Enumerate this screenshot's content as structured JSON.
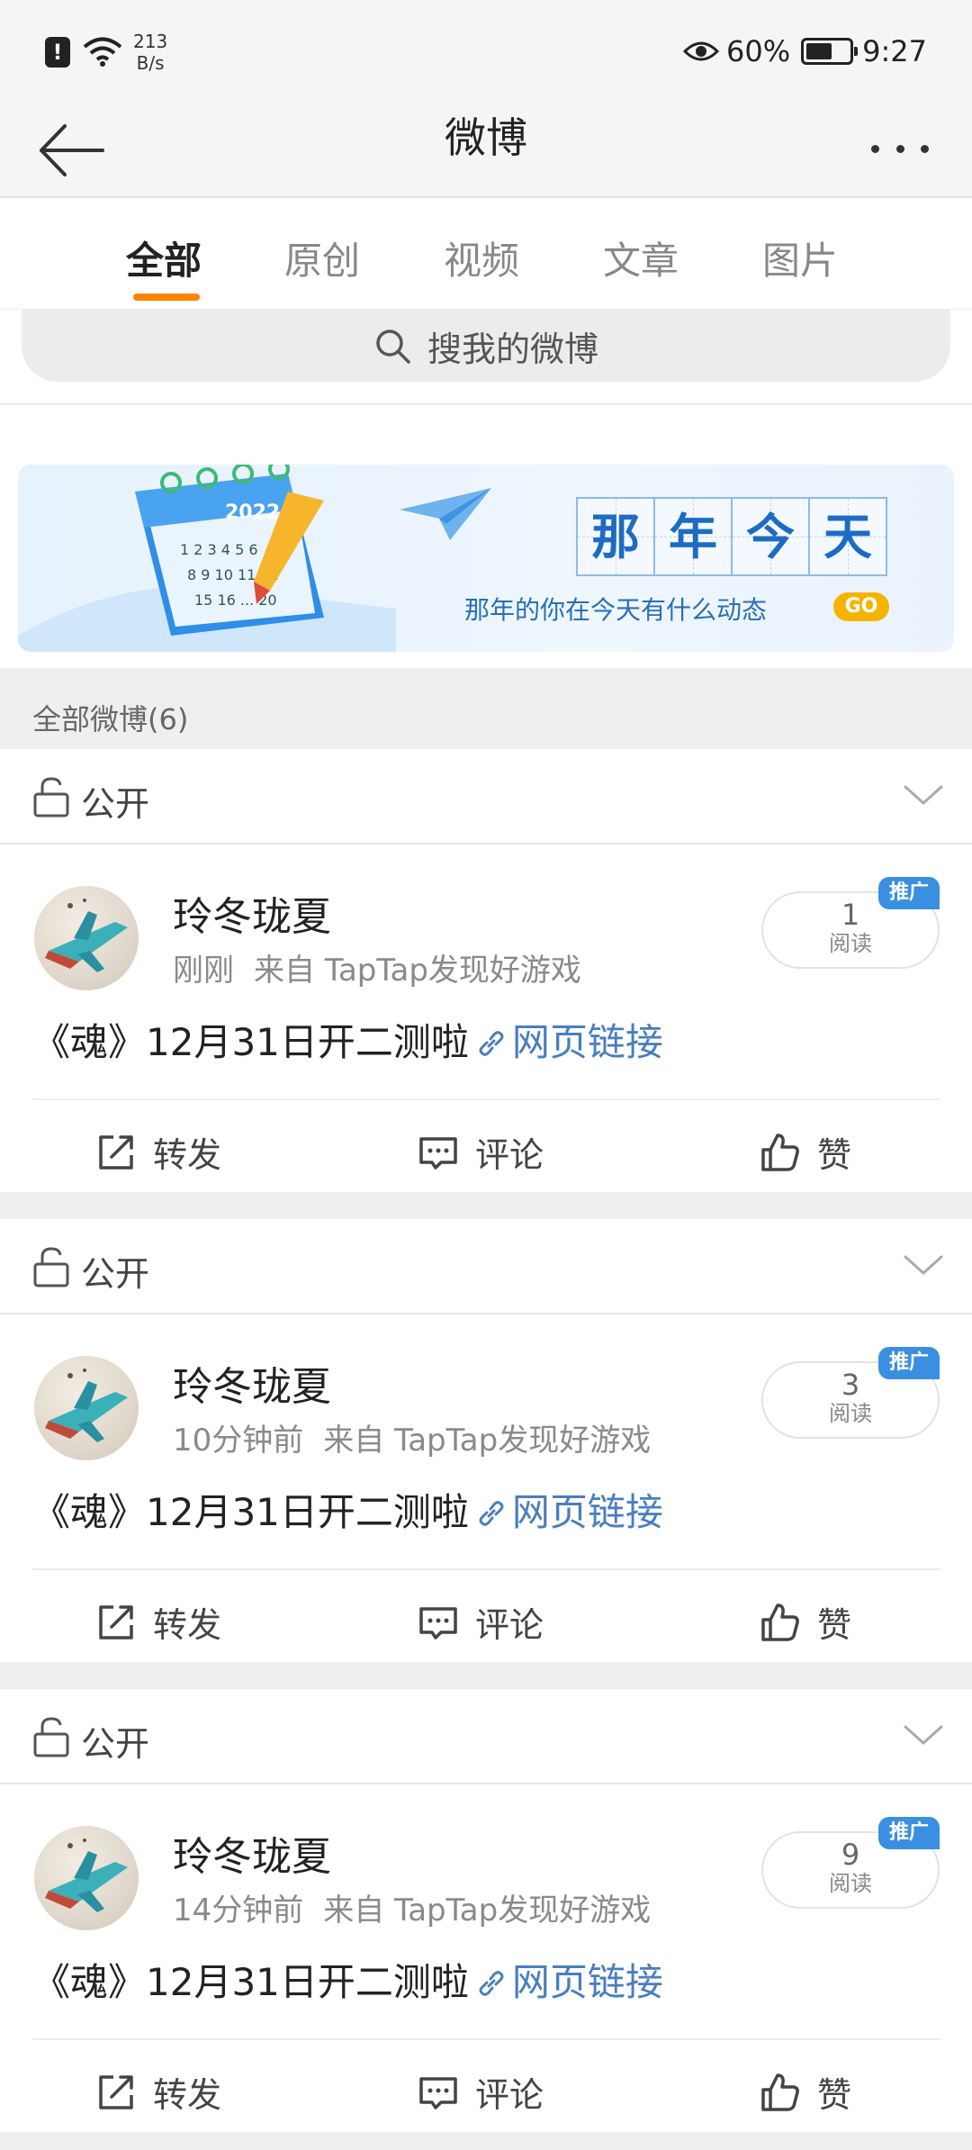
{
  "status_bar": {
    "net_speed_value": "213",
    "net_speed_unit": "B/s",
    "battery": "60%",
    "battery_level": 0.6,
    "time": "9:27"
  },
  "header": {
    "title": "微博"
  },
  "tabs": [
    {
      "label": "全部",
      "active": true
    },
    {
      "label": "原创",
      "active": false
    },
    {
      "label": "视频",
      "active": false
    },
    {
      "label": "文章",
      "active": false
    },
    {
      "label": "图片",
      "active": false
    }
  ],
  "search": {
    "placeholder": "搜我的微博"
  },
  "banner": {
    "cal_year": "2022",
    "title_chars": [
      "那",
      "年",
      "今",
      "天"
    ],
    "subtitle": "那年的你在今天有什么动态",
    "go": "GO"
  },
  "count": {
    "label": "全部微博(6)"
  },
  "posts": [
    {
      "privacy": "公开",
      "author": "玲冬珑夏",
      "time": "刚刚",
      "source": "来自 TapTap发现好游戏",
      "reads": "1",
      "reads_label": "阅读",
      "promo": "推广",
      "text": "《魂》12月31日开二测啦",
      "link_text": "网页链接",
      "actions": {
        "repost": "转发",
        "comment": "评论",
        "like": "赞"
      }
    },
    {
      "privacy": "公开",
      "author": "玲冬珑夏",
      "time": "10分钟前",
      "source": "来自 TapTap发现好游戏",
      "reads": "3",
      "reads_label": "阅读",
      "promo": "推广",
      "text": "《魂》12月31日开二测啦",
      "link_text": "网页链接",
      "actions": {
        "repost": "转发",
        "comment": "评论",
        "like": "赞"
      }
    },
    {
      "privacy": "公开",
      "author": "玲冬珑夏",
      "time": "14分钟前",
      "source": "来自 TapTap发现好游戏",
      "reads": "9",
      "reads_label": "阅读",
      "promo": "推广",
      "text": "《魂》12月31日开二测啦",
      "link_text": "网页链接",
      "actions": {
        "repost": "转发",
        "comment": "评论",
        "like": "赞"
      }
    }
  ],
  "colors": {
    "accent": "#ff8200",
    "link": "#4a7ebc",
    "promo": "#3a8fe0",
    "banner_text": "#1d6cc2"
  }
}
